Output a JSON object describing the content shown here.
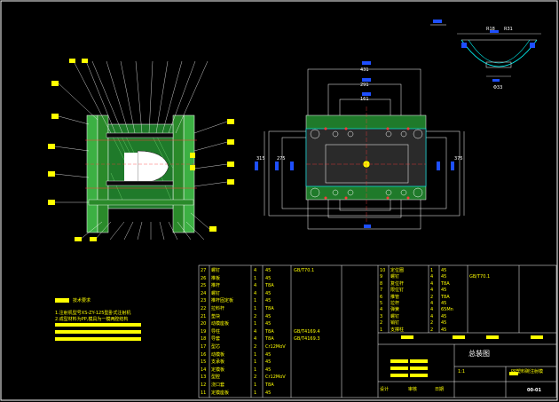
{
  "tech_requirements": {
    "title": "技术要求",
    "lines": [
      "1.注射机型号XS-ZY-125型卧式注射机",
      "2.成型材料为PP,模具为一模两腔结构"
    ]
  },
  "plan_dims": {
    "top1": "431",
    "top2": "291",
    "top3": "161",
    "left1": "315",
    "left2": "275",
    "right1": "375"
  },
  "detail_dims": {
    "d1": "R18",
    "d2": "R31",
    "d3": "Φ33"
  },
  "title_block": {
    "drawing_name": "总装图",
    "product_name": "PP塑料碗注射模",
    "scale": "1:1",
    "sheet": "00-01",
    "design": "设计",
    "check": "审核",
    "date": "日期"
  },
  "bom_left": [
    {
      "no": "27",
      "name": "螺钉",
      "qty": "4",
      "material": "45",
      "note": "GB/T70.1"
    },
    {
      "no": "26",
      "name": "推板",
      "qty": "1",
      "material": "45",
      "note": ""
    },
    {
      "no": "25",
      "name": "推杆",
      "qty": "4",
      "material": "T8A",
      "note": ""
    },
    {
      "no": "24",
      "name": "螺钉",
      "qty": "4",
      "material": "45",
      "note": ""
    },
    {
      "no": "23",
      "name": "推杆固定板",
      "qty": "1",
      "material": "45",
      "note": ""
    },
    {
      "no": "22",
      "name": "拉料杆",
      "qty": "1",
      "material": "T8A",
      "note": ""
    },
    {
      "no": "21",
      "name": "垫块",
      "qty": "2",
      "material": "45",
      "note": ""
    },
    {
      "no": "20",
      "name": "动模座板",
      "qty": "1",
      "material": "45",
      "note": ""
    },
    {
      "no": "19",
      "name": "导柱",
      "qty": "4",
      "material": "T8A",
      "note": "GB/T4169.4"
    },
    {
      "no": "18",
      "name": "导套",
      "qty": "4",
      "material": "T8A",
      "note": "GB/T4169.3"
    },
    {
      "no": "17",
      "name": "型芯",
      "qty": "2",
      "material": "Cr12MoV",
      "note": ""
    },
    {
      "no": "16",
      "name": "动模板",
      "qty": "1",
      "material": "45",
      "note": ""
    },
    {
      "no": "15",
      "name": "支承板",
      "qty": "1",
      "material": "45",
      "note": ""
    },
    {
      "no": "14",
      "name": "定模板",
      "qty": "1",
      "material": "45",
      "note": ""
    },
    {
      "no": "13",
      "name": "型腔",
      "qty": "2",
      "material": "Cr12MoV",
      "note": ""
    },
    {
      "no": "12",
      "name": "浇口套",
      "qty": "1",
      "material": "T8A",
      "note": ""
    },
    {
      "no": "11",
      "name": "定模座板",
      "qty": "1",
      "material": "45",
      "note": ""
    }
  ],
  "bom_right": [
    {
      "no": "10",
      "name": "定位圈",
      "qty": "1",
      "material": "45",
      "note": ""
    },
    {
      "no": "9",
      "name": "螺钉",
      "qty": "4",
      "material": "45",
      "note": "GB/T70.1"
    },
    {
      "no": "8",
      "name": "复位杆",
      "qty": "4",
      "material": "T8A",
      "note": ""
    },
    {
      "no": "7",
      "name": "限位钉",
      "qty": "4",
      "material": "45",
      "note": ""
    },
    {
      "no": "6",
      "name": "推管",
      "qty": "2",
      "material": "T8A",
      "note": ""
    },
    {
      "no": "5",
      "name": "拉杆",
      "qty": "4",
      "material": "45",
      "note": ""
    },
    {
      "no": "4",
      "name": "弹簧",
      "qty": "4",
      "material": "65Mn",
      "note": ""
    },
    {
      "no": "3",
      "name": "螺钉",
      "qty": "4",
      "material": "45",
      "note": ""
    },
    {
      "no": "2",
      "name": "销钉",
      "qty": "2",
      "material": "45",
      "note": ""
    },
    {
      "no": "1",
      "name": "支撑柱",
      "qty": "2",
      "material": "45",
      "note": ""
    }
  ]
}
